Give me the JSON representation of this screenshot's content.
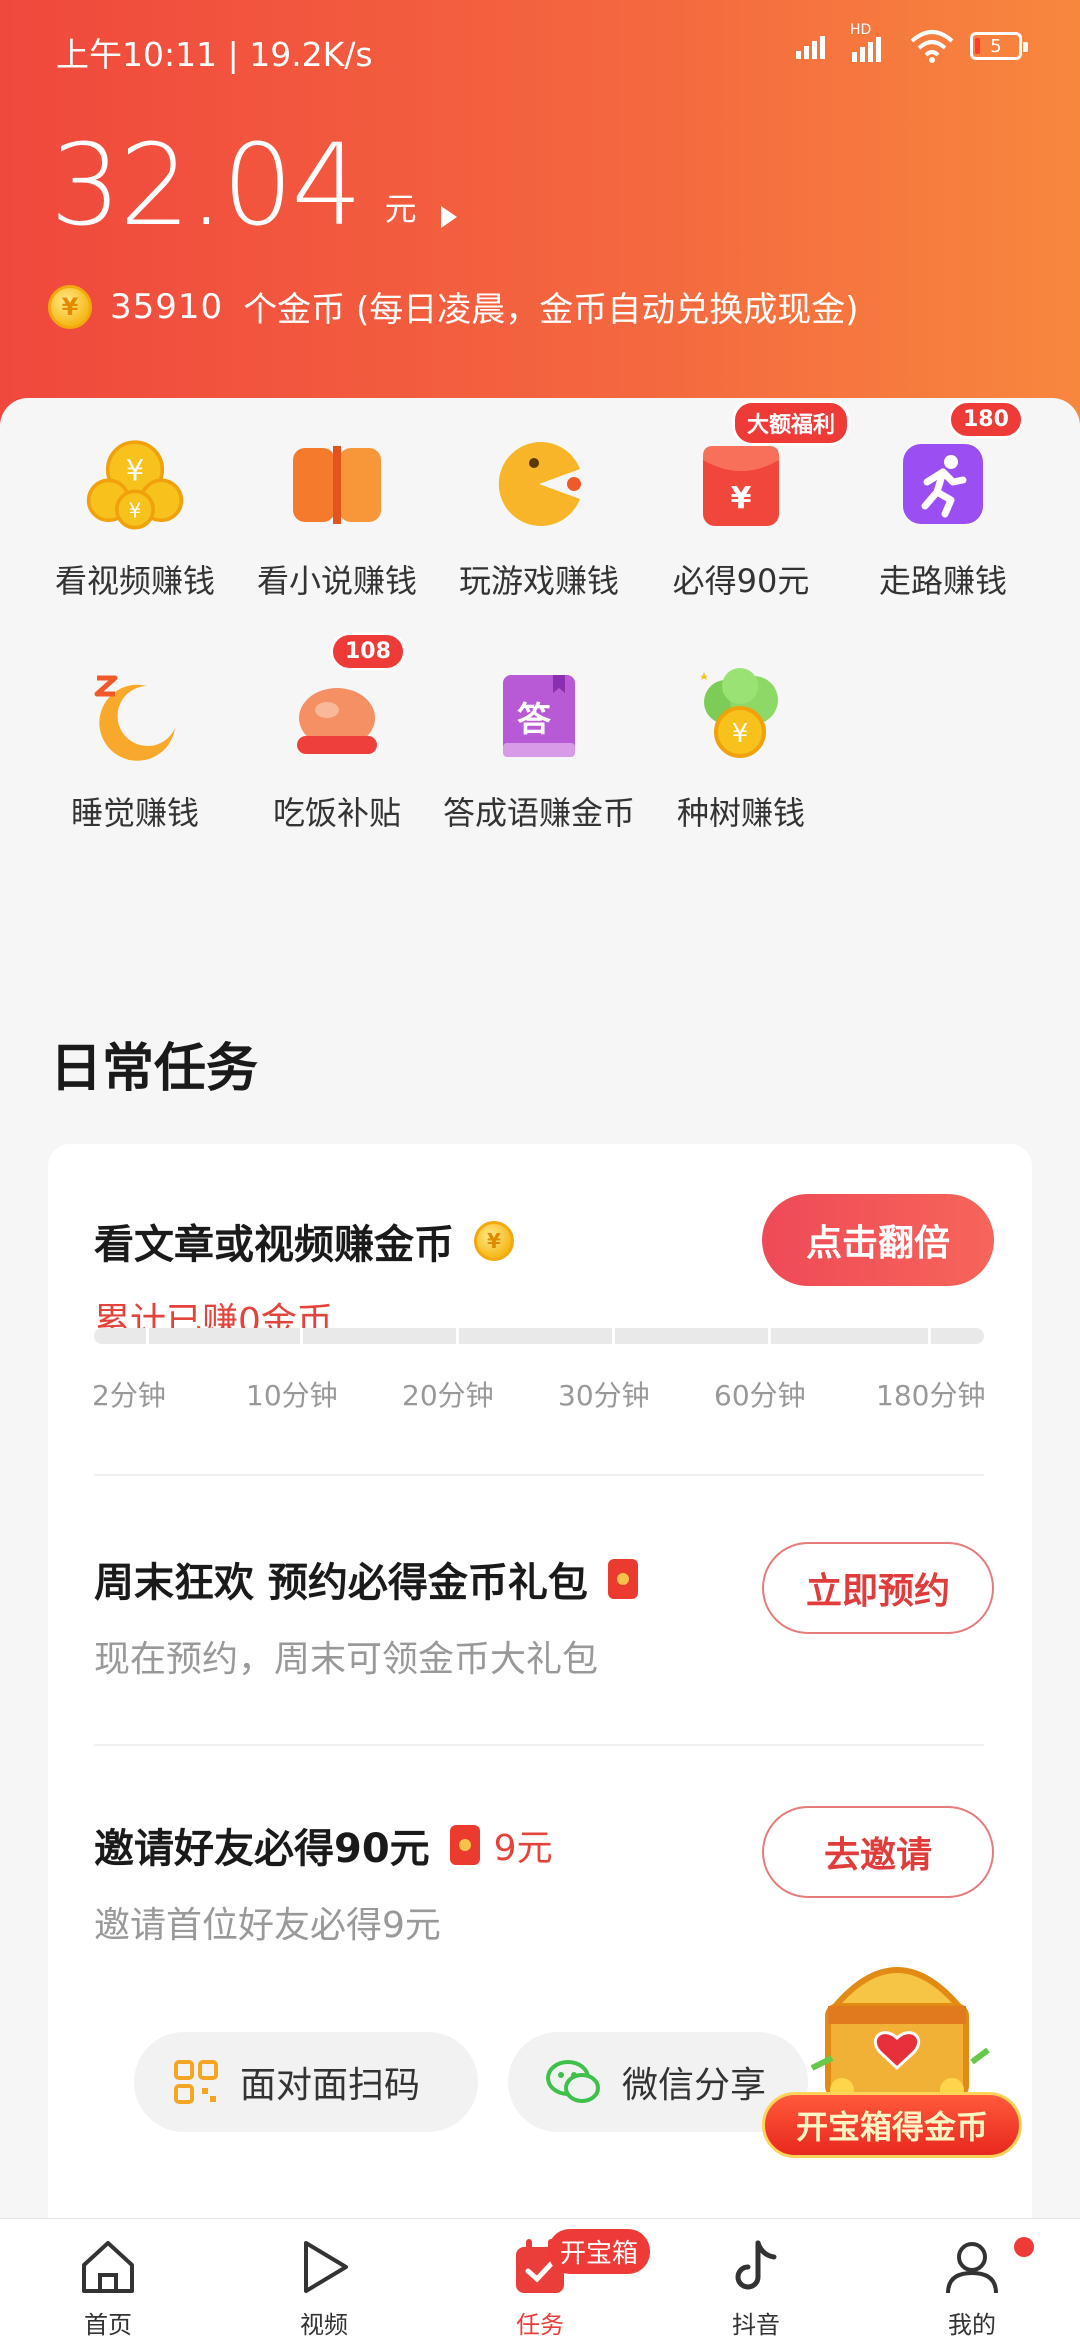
{
  "status_bar": {
    "time_speed": "上午10:11 | 19.2K/s",
    "network": "HD",
    "battery": "5"
  },
  "header": {
    "balance": "32.04",
    "balance_unit": "元",
    "coin_symbol": "¥",
    "coin_count": "35910",
    "coin_note": "个金币 (每日凌晨，金币自动兑换成现金)"
  },
  "grid": [
    {
      "label": "看视频赚钱",
      "icon": "coin-stack-icon"
    },
    {
      "label": "看小说赚钱",
      "icon": "book-icon"
    },
    {
      "label": "玩游戏赚钱",
      "icon": "pacman-icon"
    },
    {
      "label": "必得90元",
      "icon": "red-envelope-icon",
      "badge": "大额福利"
    },
    {
      "label": "走路赚钱",
      "icon": "running-icon",
      "badge": "180"
    },
    {
      "label": "睡觉赚钱",
      "icon": "moon-icon"
    },
    {
      "label": "吃饭补贴",
      "icon": "chicken-icon",
      "badge": "108"
    },
    {
      "label": "答成语赚金币",
      "icon": "quiz-book-icon",
      "icon_text": "答"
    },
    {
      "label": "种树赚钱",
      "icon": "money-tree-icon"
    }
  ],
  "section_title": "日常任务",
  "tasks": {
    "watch": {
      "title": "看文章或视频赚金币",
      "subtitle": "累计已赚0金币",
      "button": "点击翻倍",
      "progress_labels": [
        "2分钟",
        "10分钟",
        "20分钟",
        "30分钟",
        "60分钟",
        "180分钟"
      ],
      "progress": 0
    },
    "weekend": {
      "title": "周末狂欢 预约必得金币礼包",
      "subtitle": "现在预约，周末可领金币大礼包",
      "button": "立即预约"
    },
    "invite": {
      "title": "邀请好友必得90元",
      "bonus": "9元",
      "subtitle": "邀请首位好友必得9元",
      "button": "去邀请"
    }
  },
  "share": {
    "face_to_face": "面对面扫码",
    "wechat": "微信分享"
  },
  "treasure": {
    "label": "开宝箱得金币"
  },
  "nav": [
    {
      "label": "首页",
      "icon": "home-icon"
    },
    {
      "label": "视频",
      "icon": "play-icon"
    },
    {
      "label": "任务",
      "icon": "task-calendar-icon",
      "badge": "开宝箱",
      "active": true
    },
    {
      "label": "抖音",
      "icon": "tiktok-icon"
    },
    {
      "label": "我的",
      "icon": "profile-icon",
      "dot": true
    }
  ],
  "colors": {
    "header_start": "#f0483d",
    "header_end": "#f8873e",
    "accent_red": "#e2443b",
    "coin_gold": "#f6b91a"
  }
}
